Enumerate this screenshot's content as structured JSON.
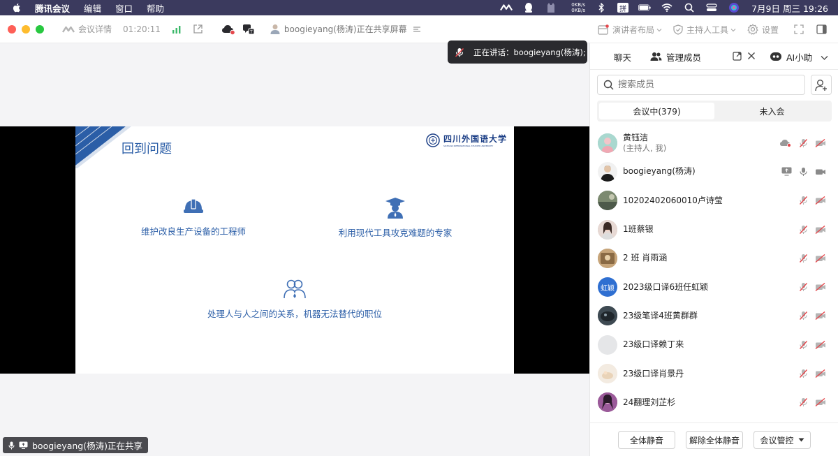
{
  "menubar": {
    "app_name": "腾讯会议",
    "items": [
      "编辑",
      "窗口",
      "帮助"
    ],
    "net_up": "0KB/s",
    "net_down": "0KB/s",
    "input_method": "拼",
    "clock": "7月9日 周三  19:26"
  },
  "toolbar": {
    "meeting_details": "会议详情",
    "duration": "01:20:11",
    "sharing_label": "boogieyang(杨涛)正在共享屏幕",
    "speaker_layout": "演讲者布局",
    "host_tools": "主持人工具",
    "settings": "设置"
  },
  "toast": {
    "text": "正在讲话：boogieyang(杨涛);"
  },
  "slide": {
    "title": "回到问题",
    "logo_text": "四川外国语大学",
    "logo_subtext": "SICHUAN INTERNATIONAL STUDIES UNIVERSITY",
    "points": [
      {
        "text": "维护改良生产设备的工程师",
        "icon": "hardhat-icon"
      },
      {
        "text": "利用现代工具攻克难题的专家",
        "icon": "graduate-icon"
      },
      {
        "text": "处理人与人之间的关系，机器无法替代的职位",
        "icon": "people-icon"
      }
    ]
  },
  "share_status": "boogieyang(杨涛)正在共享",
  "panel": {
    "tab_chat": "聊天",
    "tab_members": "管理成员",
    "tab_ai": "AI小助",
    "search_placeholder": "搜索成员",
    "seg_in_meeting": "会议中(379)",
    "seg_not_joined": "未入会",
    "members": [
      {
        "name": "黄钰洁",
        "sub": "(主持人, 我)",
        "avatar_color": "#8fc7c0",
        "avatar_text": ""
      },
      {
        "name": "boogieyang(杨涛)",
        "sub": "",
        "avatar_color": "#2b2b2b",
        "avatar_text": ""
      },
      {
        "name": "10202402060010卢诗莹",
        "sub": "",
        "avatar_color": "#6b7a6a",
        "avatar_text": ""
      },
      {
        "name": "1班蔡银",
        "sub": "",
        "avatar_color": "#c9b1a8",
        "avatar_text": ""
      },
      {
        "name": "2 班 肖雨涵",
        "sub": "",
        "avatar_color": "#b49166",
        "avatar_text": ""
      },
      {
        "name": "2023级口译6班任虹颖",
        "sub": "",
        "avatar_color": "#2f6fd1",
        "avatar_text": "虹颖"
      },
      {
        "name": "23级笔译4班黄群群",
        "sub": "",
        "avatar_color": "#3e4a52",
        "avatar_text": ""
      },
      {
        "name": "23级口译赖丁来",
        "sub": "",
        "avatar_color": "#e5e6e8",
        "avatar_text": ""
      },
      {
        "name": "23级口译肖景丹",
        "sub": "",
        "avatar_color": "#efe4d6",
        "avatar_text": ""
      },
      {
        "name": "24翻理刘芷杉",
        "sub": "",
        "avatar_color": "#7a3b6d",
        "avatar_text": ""
      }
    ],
    "footer": {
      "mute_all": "全体静音",
      "unmute_all": "解除全体静音",
      "meeting_control": "会议管控"
    }
  },
  "colors": {
    "accent_blue": "#2b5ea7",
    "muted_red": "#e5484d",
    "menubar_bg": "#3b3a5e"
  }
}
